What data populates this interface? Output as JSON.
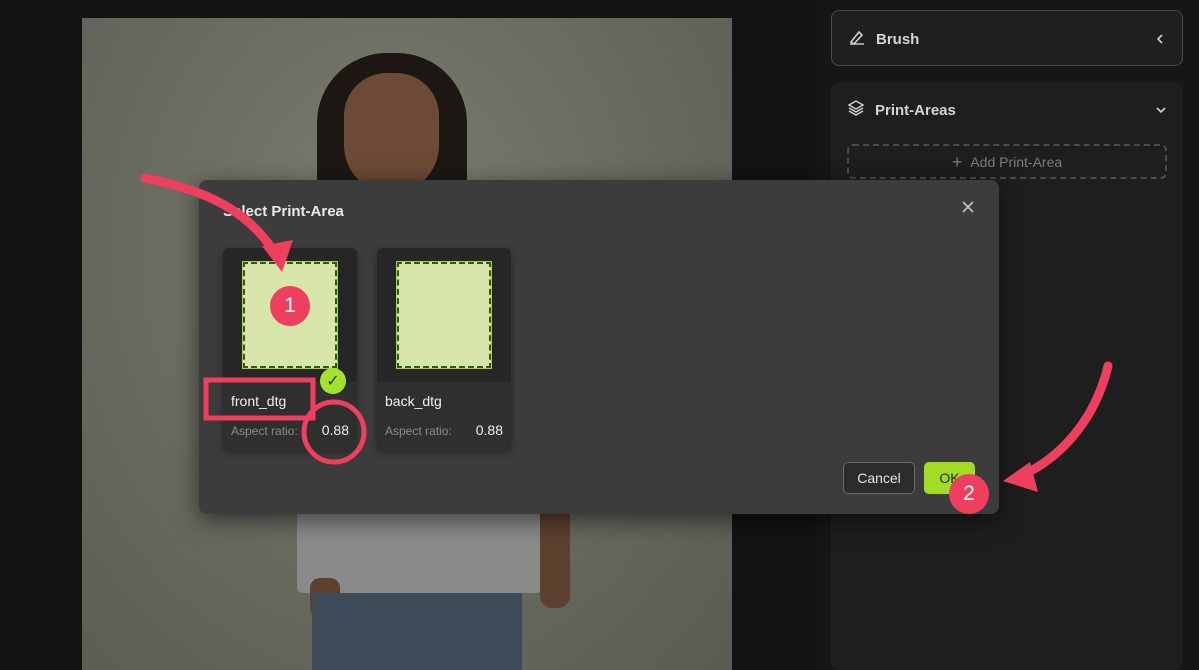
{
  "right_panel": {
    "brush": {
      "label": "Brush",
      "icon": "pen-icon",
      "chevron": "chevron-left-icon"
    },
    "print_areas": {
      "label": "Print-Areas",
      "icon": "layers-icon",
      "chevron": "chevron-down-icon",
      "add_label": "Add Print-Area"
    }
  },
  "modal": {
    "title": "Select Print-Area",
    "close_icon": "close-icon",
    "areas": [
      {
        "name": "front_dtg",
        "ratio_label": "Aspect ratio:",
        "ratio_value": "0.88",
        "selected": true
      },
      {
        "name": "back_dtg",
        "ratio_label": "Aspect ratio:",
        "ratio_value": "0.88",
        "selected": false
      }
    ],
    "cancel_label": "Cancel",
    "ok_label": "OK"
  },
  "annotations": {
    "steps": [
      "1",
      "2"
    ],
    "color": "#ef3f5f"
  },
  "colors": {
    "accent": "#a3dd23",
    "print_area_fill": "#d8e6ab",
    "modal_bg": "#3c3c3c",
    "app_bg": "#131313"
  }
}
